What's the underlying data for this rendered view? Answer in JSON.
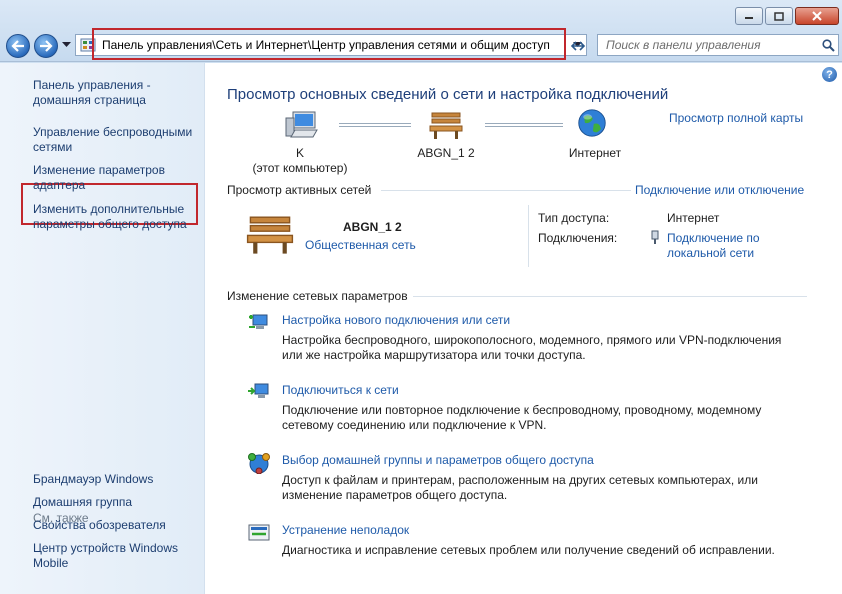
{
  "window": {
    "buttons": [
      "minimize",
      "maximize",
      "close"
    ]
  },
  "address": {
    "path": "Панель управления\\Сеть и Интернет\\Центр управления сетями и общим доступ"
  },
  "search": {
    "placeholder": "Поиск в панели управления"
  },
  "sidebar": {
    "home": "Панель управления - домашняя страница",
    "links": [
      "Управление беспроводными сетями",
      "Изменение параметров адаптера",
      "Изменить дополнительные параметры общего доступа"
    ],
    "see_also_title": "См. также",
    "see_also": [
      "Брандмауэр Windows",
      "Домашняя группа",
      "Свойства обозревателя",
      "Центр устройств Windows Mobile"
    ]
  },
  "main": {
    "heading": "Просмотр основных сведений о сети и настройка подключений",
    "full_map": "Просмотр полной карты",
    "map": {
      "computer_name": "K",
      "computer_sub": "(этот компьютер)",
      "network_name": "ABGN_1  2",
      "internet": "Интернет"
    },
    "active": {
      "title": "Просмотр активных сетей",
      "connect_link": "Подключение или отключение",
      "network_name": "ABGN_1  2",
      "network_type": "Общественная сеть",
      "access_label": "Тип доступа:",
      "access_value": "Интернет",
      "connections_label": "Подключения:",
      "connections_value": "Подключение по локальной сети"
    },
    "change": {
      "title": "Изменение сетевых параметров",
      "tasks": [
        {
          "title": "Настройка нового подключения или сети",
          "desc": "Настройка беспроводного, широкополосного, модемного, прямого или VPN-подключения или же настройка маршрутизатора или точки доступа.",
          "icon": "new-connection-icon"
        },
        {
          "title": "Подключиться к сети",
          "desc": "Подключение или повторное подключение к беспроводному, проводному, модемному сетевому соединению или подключение к VPN.",
          "icon": "connect-network-icon"
        },
        {
          "title": "Выбор домашней группы и параметров общего доступа",
          "desc": "Доступ к файлам и принтерам, расположенным на других сетевых компьютерах, или изменение параметров общего доступа.",
          "icon": "homegroup-icon"
        },
        {
          "title": "Устранение неполадок",
          "desc": "Диагностика и исправление сетевых проблем или получение сведений об исправлении.",
          "icon": "troubleshoot-icon"
        }
      ]
    }
  },
  "colors": {
    "link": "#1e5aa9",
    "heading": "#1e3f7a",
    "highlight": "#c1272d"
  }
}
